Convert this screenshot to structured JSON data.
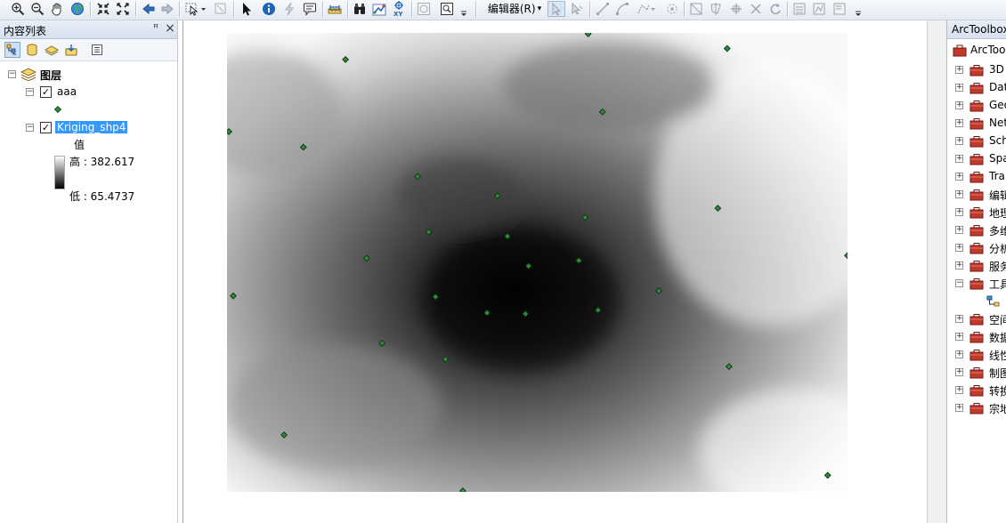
{
  "toolbar": {
    "editor_label": "编辑器(R)",
    "editor_arrow": "▾"
  },
  "toc": {
    "title": "内容列表",
    "pin_glyph": "ꟸ",
    "close_glyph": "×",
    "root_layer": "图层",
    "layers": [
      {
        "name": "aaa",
        "checked": true
      },
      {
        "name": "Kriging_shp4",
        "checked": true,
        "selected": true
      }
    ],
    "legend": {
      "field": "值",
      "high_label": "高 : 382.617",
      "low_label": "低 : 65.4737"
    }
  },
  "map": {
    "points": [
      [
        0.582,
        0.002
      ],
      [
        0.806,
        0.034
      ],
      [
        0.191,
        0.058
      ],
      [
        0.605,
        0.172
      ],
      [
        0.003,
        0.215
      ],
      [
        0.123,
        0.249
      ],
      [
        0.307,
        0.313
      ],
      [
        0.436,
        0.355
      ],
      [
        0.791,
        0.382
      ],
      [
        0.577,
        0.402
      ],
      [
        0.325,
        0.434
      ],
      [
        0.452,
        0.443
      ],
      [
        1.0,
        0.485
      ],
      [
        0.225,
        0.491
      ],
      [
        0.567,
        0.496
      ],
      [
        0.486,
        0.508
      ],
      [
        0.696,
        0.562
      ],
      [
        0.01,
        0.573
      ],
      [
        0.336,
        0.575
      ],
      [
        0.598,
        0.604
      ],
      [
        0.419,
        0.61
      ],
      [
        0.481,
        0.612
      ],
      [
        0.25,
        0.676
      ],
      [
        0.352,
        0.711
      ],
      [
        0.809,
        0.727
      ],
      [
        0.092,
        0.876
      ],
      [
        0.968,
        0.964
      ],
      [
        0.38,
        0.998
      ]
    ]
  },
  "arctoolbox": {
    "title": "ArcToolbox",
    "root": "ArcToolbox",
    "items": [
      {
        "label": "3D",
        "expand": "+"
      },
      {
        "label": "Dat",
        "expand": "+"
      },
      {
        "label": "Geo",
        "expand": "+"
      },
      {
        "label": "Net",
        "expand": "+"
      },
      {
        "label": "Sch",
        "expand": "+"
      },
      {
        "label": "Spa",
        "expand": "+"
      },
      {
        "label": "Tra",
        "expand": "+"
      },
      {
        "label": "编辑",
        "expand": "+"
      },
      {
        "label": "地理",
        "expand": "+"
      },
      {
        "label": "多维",
        "expand": "+"
      },
      {
        "label": "分析",
        "expand": "+"
      },
      {
        "label": "服务",
        "expand": "+"
      },
      {
        "label": "工具",
        "expand": "−"
      },
      {
        "label": "",
        "expand": "",
        "child": true
      },
      {
        "label": "空间",
        "expand": "+"
      },
      {
        "label": "数据",
        "expand": "+"
      },
      {
        "label": "线性",
        "expand": "+"
      },
      {
        "label": "制图",
        "expand": "+"
      },
      {
        "label": "转换",
        "expand": "+"
      },
      {
        "label": "宗地",
        "expand": "+"
      }
    ]
  },
  "colors": {
    "selection": "#3399ff",
    "point_fill": "#2e8b3a",
    "toolbox_red": "#c0392b"
  }
}
